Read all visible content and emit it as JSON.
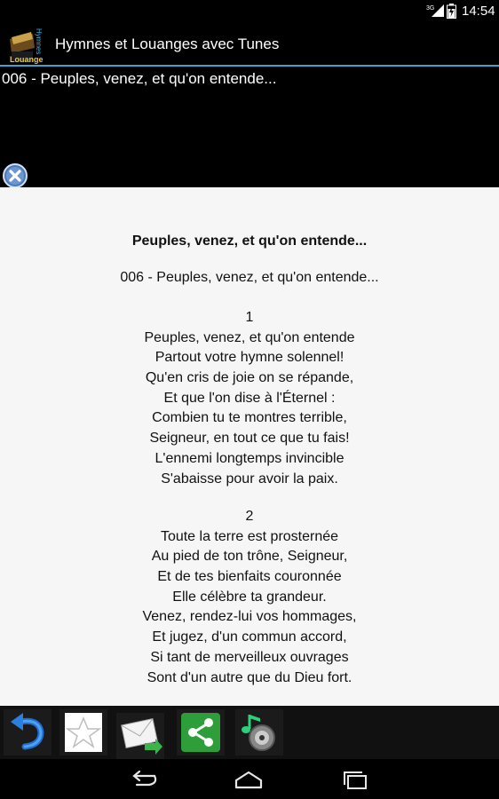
{
  "status_bar": {
    "network": "3G",
    "time": "14:54",
    "battery_icon": "battery-charging-icon",
    "signal_icon": "signal-icon"
  },
  "app": {
    "title": "Hymnes et Louanges avec Tunes",
    "icon_text_top": "Hymnes",
    "icon_text_bottom": "Louange"
  },
  "header": {
    "hymn_subtitle": "006 - Peuples, venez, et qu'on entende..."
  },
  "hymn": {
    "title": "Peuples, venez, et qu'on entende...",
    "subtitle": "006 - Peuples, venez, et qu'on entende...",
    "stanzas": [
      {
        "number": "1",
        "lines": [
          "Peuples, venez, et qu'on entende",
          "Partout votre hymne solennel!",
          "Qu'en cris de joie on se répande,",
          "Et que l'on dise à l'Éternel :",
          "Combien tu te montres terrible,",
          "Seigneur, en tout ce que tu fais!",
          "L'ennemi longtemps invincible",
          "S'abaisse pour avoir la paix."
        ]
      },
      {
        "number": "2",
        "lines": [
          "Toute la terre est prosternée",
          "Au pied de ton trône, Seigneur,",
          "Et de tes bienfaits couronnée",
          "Elle célèbre ta grandeur.",
          "Venez, rendez-lui vos hommages,",
          "Et jugez, d'un commun accord,",
          "Si tant de merveilleux ouvrages",
          "Sont d'un autre que du Dieu fort."
        ]
      }
    ]
  },
  "toolbar": {
    "buttons": [
      "undo-icon",
      "star-icon",
      "email-icon",
      "share-icon",
      "music-icon"
    ]
  },
  "nav_bar": {
    "buttons": [
      "back-icon",
      "home-icon",
      "recents-icon"
    ]
  },
  "colors": {
    "accent": "#3aa4d3",
    "content_bg": "#f6f6f6",
    "share_green": "#2e9e3a"
  }
}
